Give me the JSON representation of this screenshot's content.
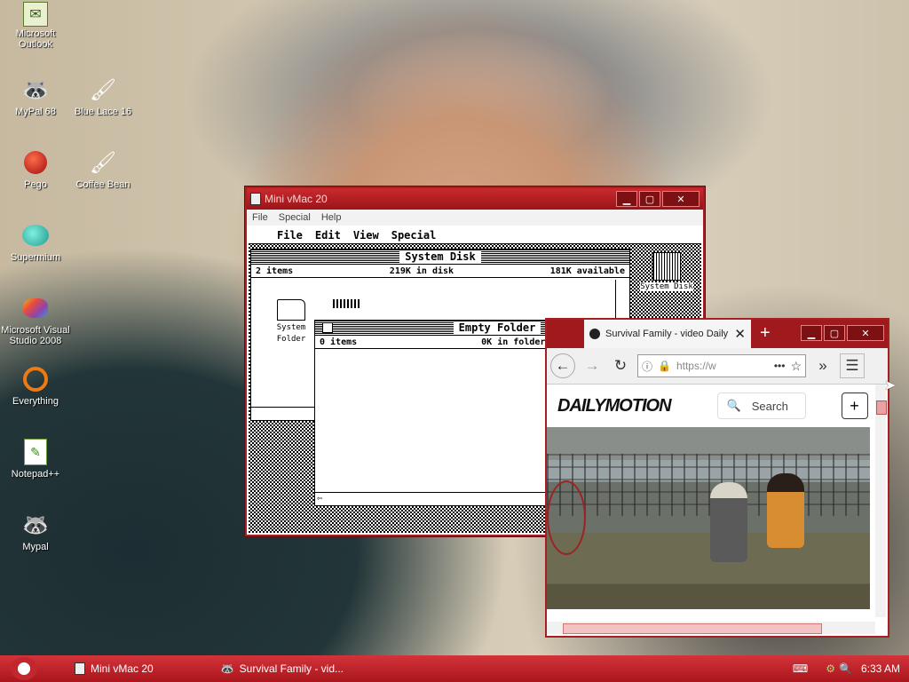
{
  "desktop": {
    "icons": [
      {
        "label": "Microsoft Outlook",
        "icon": "outlook-icon"
      },
      {
        "label": "MyPal 68",
        "icon": "mypal-icon"
      },
      {
        "label": "Blue Lace 16",
        "icon": "blue-lace-icon"
      },
      {
        "label": "Pego",
        "icon": "pego-icon"
      },
      {
        "label": "Coffee Bean",
        "icon": "coffee-bean-icon"
      },
      {
        "label": "Supermium",
        "icon": "supermium-icon"
      },
      {
        "label": "Microsoft Visual Studio 2008",
        "icon": "visual-studio-icon"
      },
      {
        "label": "Everything",
        "icon": "everything-icon"
      },
      {
        "label": "Notepad++",
        "icon": "notepadpp-icon"
      },
      {
        "label": "Mypal",
        "icon": "mypal-icon"
      }
    ]
  },
  "minivmac": {
    "title": "Mini vMac 20",
    "menu": [
      "File",
      "Special",
      "Help"
    ],
    "mac_menu": [
      "File",
      "Edit",
      "View",
      "Special"
    ],
    "system_disk": {
      "title": "System Disk",
      "items": "2 items",
      "in_disk": "219K in disk",
      "available": "181K available",
      "folder_label": "System Folder"
    },
    "desktop_disk_label": "System Disk",
    "empty_folder": {
      "title": "Empty Folder",
      "items": "0 items",
      "in_folder": "0K in folder"
    }
  },
  "browser": {
    "tab_title": "Survival Family - video Daily",
    "url": "https://w",
    "site_logo": "DAILYMOTION",
    "search_label": "Search"
  },
  "taskbar": {
    "tasks": [
      "Mini vMac 20",
      "Survival Family - vid..."
    ],
    "clock": "6:33 AM"
  },
  "colors": {
    "window_frame": "#a61f23",
    "taskbar": "#c1272d"
  }
}
